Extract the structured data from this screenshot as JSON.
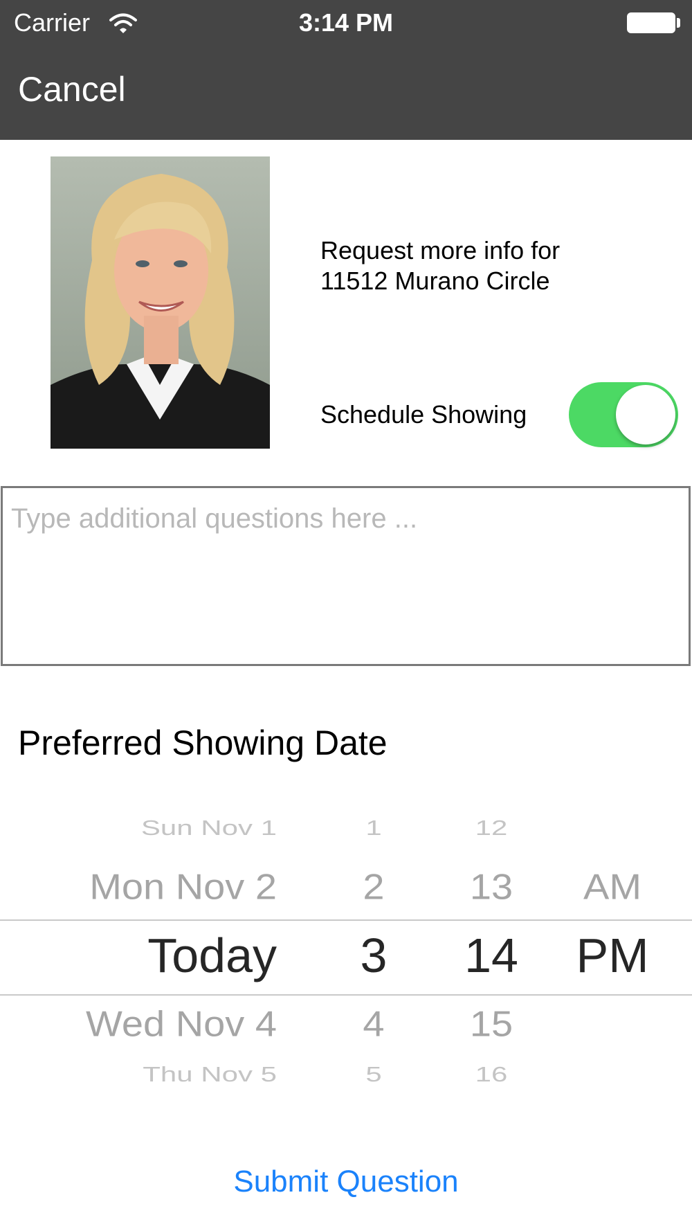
{
  "status_bar": {
    "carrier": "Carrier",
    "time": "3:14 PM"
  },
  "nav": {
    "cancel_label": "Cancel"
  },
  "agent": {
    "request_line1": "Request more info for",
    "request_line2": "11512 Murano Circle"
  },
  "schedule": {
    "label": "Schedule Showing",
    "toggle_on": true
  },
  "questions": {
    "placeholder": "Type additional questions here ...",
    "value": ""
  },
  "preferred": {
    "label": "Preferred Showing Date"
  },
  "picker": {
    "dates": [
      "Sun Nov 1",
      "Mon Nov 2",
      "Today",
      "Wed Nov 4",
      "Thu Nov 5"
    ],
    "hours": [
      "1",
      "2",
      "3",
      "4",
      "5"
    ],
    "minutes": [
      "12",
      "13",
      "14",
      "15",
      "16"
    ],
    "ampm": [
      "AM",
      "PM"
    ]
  },
  "submit": {
    "label": "Submit Question"
  },
  "colors": {
    "nav_bg": "#454545",
    "toggle_on": "#4cd964",
    "link_blue": "#1a82fb"
  }
}
